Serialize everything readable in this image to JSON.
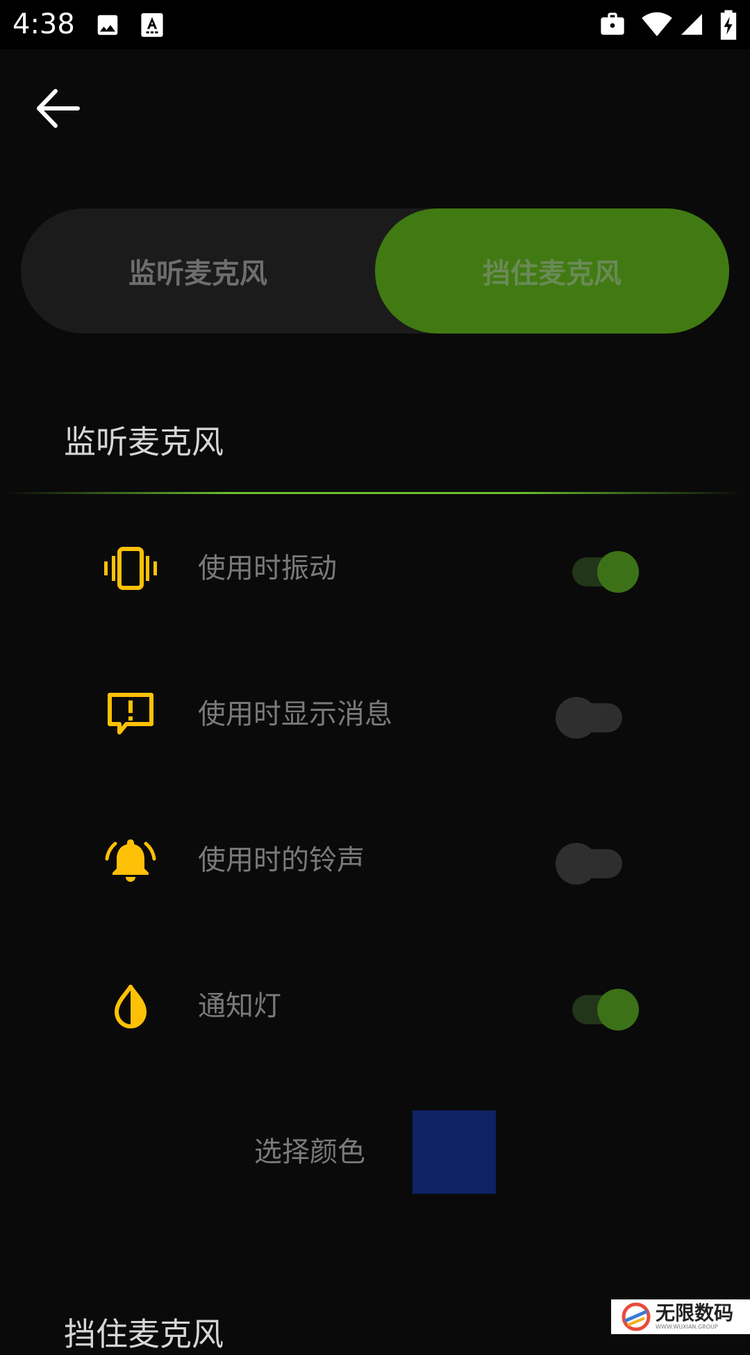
{
  "status_bar": {
    "time": "4:38",
    "left_icons": [
      "image-icon",
      "text-a-icon"
    ],
    "right_icons": [
      "briefcase-icon",
      "wifi-icon",
      "signal-icon",
      "battery-charging-icon"
    ]
  },
  "toolbar": {
    "back_icon": "arrow-left-icon"
  },
  "segmented_control": {
    "options": [
      {
        "label": "监听麦克风",
        "selected": false
      },
      {
        "label": "挡住麦克风",
        "selected": true
      }
    ],
    "selected_color": "#417a12"
  },
  "section1": {
    "title": "监听麦克风",
    "rows": [
      {
        "icon": "vibration-icon",
        "label": "使用时振动",
        "on": true
      },
      {
        "icon": "message-alert-icon",
        "label": "使用时显示消息",
        "on": false
      },
      {
        "icon": "bell-ring-icon",
        "label": "使用时的铃声",
        "on": false
      },
      {
        "icon": "notification-light-icon",
        "label": "通知灯",
        "on": true
      }
    ],
    "color_picker": {
      "label": "选择颜色",
      "color": "#0f2364"
    }
  },
  "section2": {
    "title": "挡住麦克风"
  },
  "colors": {
    "accent": "#417a12",
    "icon": "#ffc107",
    "background": "#0a0a0a"
  },
  "watermark": {
    "main": "无限数码",
    "sub": "WWW.WUXIAN.GROUP"
  }
}
